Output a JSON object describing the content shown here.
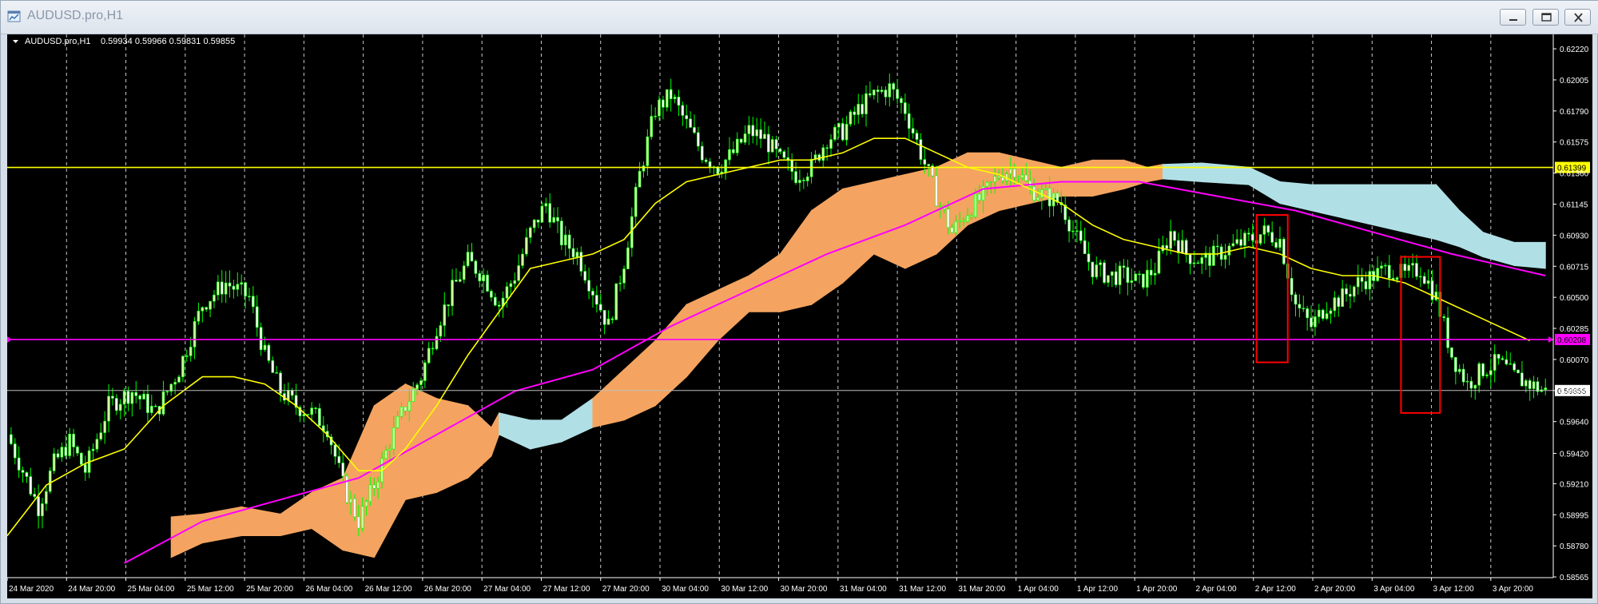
{
  "window": {
    "title": "AUDUSD.pro,H1"
  },
  "chart_header": {
    "symbol_tf": "AUDUSD.pro,H1",
    "ohlc": "0.59934 0.59966 0.59831 0.59855"
  },
  "colors": {
    "background": "#000000",
    "bull_candle": "#cfffa0",
    "bear_candle": "#ffffff",
    "wick": "#00ff00",
    "grid": "#c8c8c8",
    "ma_fast": "#ffff00",
    "ma_slow": "#ff00ff",
    "cloud_bull": "#f4a460",
    "cloud_bear": "#b0e0e6",
    "price_line": "#c0c0c0",
    "marker_box": "#ff0000"
  },
  "chart_data": {
    "type": "candlestick",
    "symbol": "AUDUSD.pro",
    "timeframe": "H1",
    "ylim": [
      0.5856,
      0.6232
    ],
    "y_ticks": [
      "0.62220",
      "0.62005",
      "0.61790",
      "0.61575",
      "0.61360",
      "0.61145",
      "0.60930",
      "0.60715",
      "0.60500",
      "0.60285",
      "0.60070",
      "0.59855",
      "0.59640",
      "0.59420",
      "0.59210",
      "0.58995",
      "0.58780",
      "0.58565"
    ],
    "x_ticks": [
      "24 Mar 2020",
      "24 Mar 20:00",
      "25 Mar 04:00",
      "25 Mar 12:00",
      "25 Mar 20:00",
      "26 Mar 04:00",
      "26 Mar 12:00",
      "26 Mar 20:00",
      "27 Mar 04:00",
      "27 Mar 12:00",
      "27 Mar 20:00",
      "30 Mar 04:00",
      "30 Mar 12:00",
      "30 Mar 20:00",
      "31 Mar 04:00",
      "31 Mar 12:00",
      "31 Mar 20:00",
      "1 Apr 04:00",
      "1 Apr 12:00",
      "1 Apr 20:00",
      "2 Apr 04:00",
      "2 Apr 12:00",
      "2 Apr 20:00",
      "3 Apr 04:00",
      "3 Apr 12:00",
      "3 Apr 20:00"
    ],
    "horizontal_lines": [
      {
        "label": "0.61399",
        "value": 0.61399,
        "color": "#ffff00"
      },
      {
        "label": "0.60208",
        "value": 0.60208,
        "color": "#ff00ff"
      },
      {
        "label": "0.59855",
        "value": 0.59855,
        "color": "#c0c0c0"
      }
    ],
    "close_path": [
      [
        0,
        0.5955
      ],
      [
        4,
        0.593
      ],
      [
        8,
        0.5905
      ],
      [
        12,
        0.5935
      ],
      [
        16,
        0.595
      ],
      [
        20,
        0.593
      ],
      [
        26,
        0.5975
      ],
      [
        32,
        0.5985
      ],
      [
        38,
        0.597
      ],
      [
        44,
        0.6
      ],
      [
        50,
        0.6045
      ],
      [
        56,
        0.606
      ],
      [
        62,
        0.605
      ],
      [
        66,
        0.601
      ],
      [
        70,
        0.5985
      ],
      [
        74,
        0.5975
      ],
      [
        78,
        0.597
      ],
      [
        82,
        0.596
      ],
      [
        86,
        0.592
      ],
      [
        90,
        0.5895
      ],
      [
        94,
        0.592
      ],
      [
        98,
        0.595
      ],
      [
        102,
        0.5975
      ],
      [
        106,
        0.5995
      ],
      [
        110,
        0.603
      ],
      [
        114,
        0.6055
      ],
      [
        118,
        0.6075
      ],
      [
        122,
        0.6065
      ],
      [
        126,
        0.6045
      ],
      [
        130,
        0.6065
      ],
      [
        134,
        0.6095
      ],
      [
        138,
        0.6115
      ],
      [
        142,
        0.609
      ],
      [
        146,
        0.608
      ],
      [
        150,
        0.6055
      ],
      [
        154,
        0.603
      ],
      [
        158,
        0.6075
      ],
      [
        162,
        0.6135
      ],
      [
        166,
        0.618
      ],
      [
        170,
        0.619
      ],
      [
        174,
        0.617
      ],
      [
        178,
        0.615
      ],
      [
        182,
        0.614
      ],
      [
        186,
        0.615
      ],
      [
        190,
        0.6165
      ],
      [
        194,
        0.616
      ],
      [
        198,
        0.6145
      ],
      [
        202,
        0.6135
      ],
      [
        206,
        0.614
      ],
      [
        210,
        0.616
      ],
      [
        214,
        0.6165
      ],
      [
        218,
        0.618
      ],
      [
        222,
        0.619
      ],
      [
        226,
        0.6195
      ],
      [
        230,
        0.618
      ],
      [
        234,
        0.615
      ],
      [
        238,
        0.612
      ],
      [
        242,
        0.6095
      ],
      [
        246,
        0.611
      ],
      [
        250,
        0.612
      ],
      [
        254,
        0.6135
      ],
      [
        258,
        0.614
      ],
      [
        262,
        0.6125
      ],
      [
        266,
        0.612
      ],
      [
        270,
        0.6115
      ],
      [
        274,
        0.609
      ],
      [
        278,
        0.607
      ],
      [
        282,
        0.6065
      ],
      [
        286,
        0.6065
      ],
      [
        290,
        0.606
      ],
      [
        294,
        0.607
      ],
      [
        298,
        0.6095
      ],
      [
        302,
        0.608
      ],
      [
        306,
        0.6075
      ],
      [
        310,
        0.608
      ],
      [
        314,
        0.6085
      ],
      [
        318,
        0.609
      ],
      [
        322,
        0.6095
      ],
      [
        326,
        0.609
      ],
      [
        330,
        0.6045
      ],
      [
        334,
        0.603
      ],
      [
        338,
        0.6045
      ],
      [
        342,
        0.605
      ],
      [
        346,
        0.606
      ],
      [
        350,
        0.6065
      ],
      [
        354,
        0.607
      ],
      [
        358,
        0.6065
      ],
      [
        362,
        0.607
      ],
      [
        366,
        0.605
      ],
      [
        370,
        0.601
      ],
      [
        374,
        0.599
      ],
      [
        378,
        0.6
      ],
      [
        382,
        0.6005
      ],
      [
        386,
        0.5995
      ],
      [
        390,
        0.599
      ],
      [
        394,
        0.5985
      ]
    ],
    "ma_fast_path": [
      [
        0,
        0.5885
      ],
      [
        10,
        0.592
      ],
      [
        20,
        0.5935
      ],
      [
        30,
        0.5945
      ],
      [
        40,
        0.5975
      ],
      [
        50,
        0.5995
      ],
      [
        58,
        0.5995
      ],
      [
        66,
        0.599
      ],
      [
        74,
        0.5975
      ],
      [
        82,
        0.5955
      ],
      [
        90,
        0.593
      ],
      [
        96,
        0.593
      ],
      [
        102,
        0.5945
      ],
      [
        110,
        0.5975
      ],
      [
        118,
        0.601
      ],
      [
        126,
        0.604
      ],
      [
        134,
        0.607
      ],
      [
        142,
        0.6075
      ],
      [
        150,
        0.608
      ],
      [
        158,
        0.609
      ],
      [
        166,
        0.6115
      ],
      [
        174,
        0.613
      ],
      [
        182,
        0.6135
      ],
      [
        190,
        0.614
      ],
      [
        198,
        0.6145
      ],
      [
        206,
        0.6145
      ],
      [
        214,
        0.615
      ],
      [
        222,
        0.616
      ],
      [
        230,
        0.616
      ],
      [
        238,
        0.615
      ],
      [
        246,
        0.614
      ],
      [
        254,
        0.6135
      ],
      [
        262,
        0.6125
      ],
      [
        270,
        0.6115
      ],
      [
        278,
        0.61
      ],
      [
        286,
        0.609
      ],
      [
        294,
        0.6085
      ],
      [
        302,
        0.608
      ],
      [
        310,
        0.608
      ],
      [
        318,
        0.6085
      ],
      [
        326,
        0.608
      ],
      [
        334,
        0.607
      ],
      [
        342,
        0.6065
      ],
      [
        350,
        0.6065
      ],
      [
        358,
        0.606
      ],
      [
        366,
        0.605
      ],
      [
        374,
        0.604
      ],
      [
        382,
        0.603
      ],
      [
        390,
        0.602
      ]
    ],
    "ma_slow_path": [
      [
        30,
        0.5866
      ],
      [
        50,
        0.5895
      ],
      [
        70,
        0.591
      ],
      [
        90,
        0.5925
      ],
      [
        110,
        0.5955
      ],
      [
        130,
        0.5985
      ],
      [
        150,
        0.6
      ],
      [
        170,
        0.603
      ],
      [
        190,
        0.6055
      ],
      [
        210,
        0.608
      ],
      [
        230,
        0.61
      ],
      [
        250,
        0.6125
      ],
      [
        270,
        0.613
      ],
      [
        290,
        0.613
      ],
      [
        310,
        0.612
      ],
      [
        330,
        0.611
      ],
      [
        350,
        0.6095
      ],
      [
        370,
        0.608
      ],
      [
        394,
        0.6065
      ]
    ],
    "cloud": [
      [
        42,
        0.587,
        0.5898,
        "bull"
      ],
      [
        50,
        0.588,
        0.59,
        "bull"
      ],
      [
        60,
        0.5885,
        0.5905,
        "bull"
      ],
      [
        70,
        0.5885,
        0.59,
        "bull"
      ],
      [
        78,
        0.589,
        0.5915,
        "bull"
      ],
      [
        86,
        0.5875,
        0.5925,
        "bull"
      ],
      [
        94,
        0.587,
        0.5975,
        "bull"
      ],
      [
        102,
        0.591,
        0.599,
        "bull"
      ],
      [
        110,
        0.5915,
        0.598,
        "bull"
      ],
      [
        118,
        0.5925,
        0.5975,
        "bull"
      ],
      [
        124,
        0.594,
        0.596,
        "bull"
      ],
      [
        126,
        0.5955,
        0.597,
        "bear"
      ],
      [
        134,
        0.5945,
        0.5965,
        "bear"
      ],
      [
        142,
        0.595,
        0.5965,
        "bear"
      ],
      [
        150,
        0.596,
        0.598,
        "bull"
      ],
      [
        158,
        0.5965,
        0.6,
        "bull"
      ],
      [
        166,
        0.5975,
        0.602,
        "bull"
      ],
      [
        174,
        0.5995,
        0.6045,
        "bull"
      ],
      [
        182,
        0.602,
        0.6055,
        "bull"
      ],
      [
        190,
        0.604,
        0.6065,
        "bull"
      ],
      [
        198,
        0.604,
        0.608,
        "bull"
      ],
      [
        206,
        0.6045,
        0.611,
        "bull"
      ],
      [
        214,
        0.606,
        0.6125,
        "bull"
      ],
      [
        222,
        0.608,
        0.613,
        "bull"
      ],
      [
        230,
        0.607,
        0.6135,
        "bull"
      ],
      [
        238,
        0.608,
        0.614,
        "bull"
      ],
      [
        246,
        0.61,
        0.615,
        "bull"
      ],
      [
        254,
        0.611,
        0.615,
        "bull"
      ],
      [
        262,
        0.6115,
        0.6145,
        "bull"
      ],
      [
        270,
        0.612,
        0.614,
        "bull"
      ],
      [
        278,
        0.612,
        0.6145,
        "bull"
      ],
      [
        286,
        0.6125,
        0.6145,
        "bull"
      ],
      [
        292,
        0.613,
        0.614,
        "bull"
      ],
      [
        296,
        0.6132,
        0.6142,
        "bear"
      ],
      [
        306,
        0.613,
        0.6143,
        "bear"
      ],
      [
        318,
        0.6128,
        0.614,
        "bear"
      ],
      [
        326,
        0.6115,
        0.613,
        "bear"
      ],
      [
        334,
        0.611,
        0.6128,
        "bear"
      ],
      [
        342,
        0.6105,
        0.6128,
        "bear"
      ],
      [
        350,
        0.61,
        0.6128,
        "bear"
      ],
      [
        358,
        0.6095,
        0.6128,
        "bear"
      ],
      [
        366,
        0.609,
        0.6128,
        "bear"
      ],
      [
        372,
        0.6085,
        0.611,
        "bear"
      ],
      [
        378,
        0.6078,
        0.6095,
        "bear"
      ],
      [
        386,
        0.6072,
        0.6088,
        "bear"
      ],
      [
        394,
        0.607,
        0.6088,
        "bear"
      ]
    ],
    "marker_boxes": [
      {
        "t0": 320,
        "t1": 328,
        "y0": 0.6107,
        "y1": 0.6005
      },
      {
        "t0": 357,
        "t1": 367,
        "y0": 0.6078,
        "y1": 0.597
      }
    ]
  }
}
